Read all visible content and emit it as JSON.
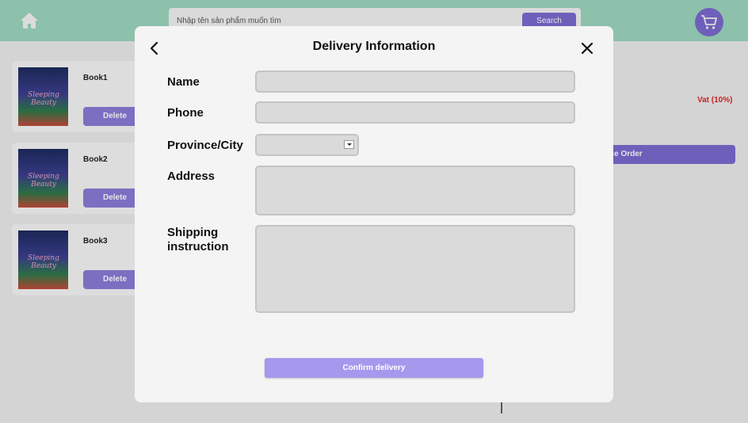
{
  "header": {
    "search_placeholder": "Nhập tên sản phẩm muốn tìm",
    "search_button": "Search"
  },
  "cart": {
    "products": [
      {
        "name": "Book1",
        "cover_title": "Sleeping Beauty",
        "delete_label": "Delete"
      },
      {
        "name": "Book2",
        "cover_title": "Sleeping Beauty",
        "delete_label": "Delete"
      },
      {
        "name": "Book3",
        "cover_title": "Sleeping Beauty",
        "delete_label": "Delete"
      }
    ],
    "vat_label": "Vat (10%)",
    "place_order_label": "ace Order"
  },
  "modal": {
    "title": "Delivery Information",
    "fields": {
      "name": {
        "label": "Name",
        "value": ""
      },
      "phone": {
        "label": "Phone",
        "value": ""
      },
      "province": {
        "label": "Province/City",
        "value": ""
      },
      "address": {
        "label": "Address",
        "value": ""
      },
      "shipping": {
        "label_line1": "Shipping",
        "label_line2": "instruction",
        "value": ""
      }
    },
    "confirm_label": "Confirm delivery"
  },
  "colors": {
    "header_bg": "#9ed7c0",
    "accent": "#7b6bd0",
    "confirm_button": "#a698ec",
    "vat_text": "#e02828"
  },
  "icons": {
    "home": "home-icon",
    "cart": "cart-icon",
    "back": "chevron-left-icon",
    "close": "close-icon",
    "dropdown": "chevron-down-icon"
  }
}
